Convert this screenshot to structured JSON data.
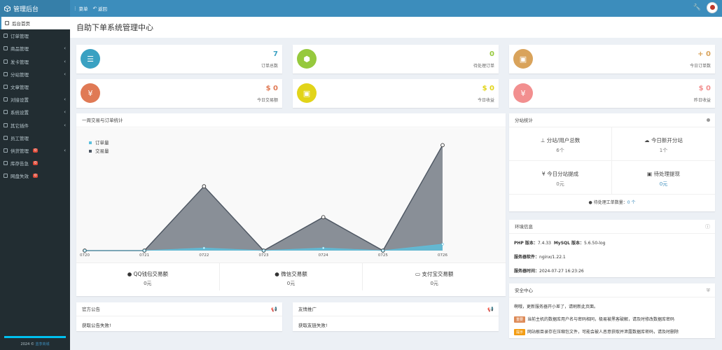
{
  "app": {
    "title": "管理后台"
  },
  "topnav": {
    "menu": "菜单",
    "back": "返回"
  },
  "sidebar": {
    "items": [
      {
        "label": "后台首页",
        "caret": false,
        "badge": ""
      },
      {
        "label": "订单管理",
        "caret": false,
        "badge": ""
      },
      {
        "label": "商品管理",
        "caret": true,
        "badge": ""
      },
      {
        "label": "发卡管理",
        "caret": true,
        "badge": ""
      },
      {
        "label": "分站管理",
        "caret": true,
        "badge": ""
      },
      {
        "label": "文章管理",
        "caret": false,
        "badge": ""
      },
      {
        "label": "对接设置",
        "caret": true,
        "badge": ""
      },
      {
        "label": "系统设置",
        "caret": true,
        "badge": ""
      },
      {
        "label": "其它插件",
        "caret": true,
        "badge": ""
      },
      {
        "label": "员工管理",
        "caret": false,
        "badge": ""
      },
      {
        "label": "供货管理",
        "caret": true,
        "badge": "0"
      },
      {
        "label": "库存告急",
        "caret": false,
        "badge": "0"
      },
      {
        "label": "网盘失效",
        "caret": false,
        "badge": "0"
      }
    ],
    "footer_year": "2024 ©",
    "footer_site": "蓝李商城"
  },
  "page": {
    "title": "自助下单系统管理中心"
  },
  "stats": [
    {
      "value": "7",
      "label": "订单总数",
      "color": "#3aa1c2",
      "icon": "list-icon"
    },
    {
      "value": "0",
      "label": "待处理订单",
      "color": "#96c93d",
      "icon": "box-icon"
    },
    {
      "value": "+ 0",
      "label": "今日订单数",
      "color": "#d9a35b",
      "icon": "briefcase-icon"
    },
    {
      "value": "$ 0",
      "label": "今日交易额",
      "color": "#e07a55",
      "icon": "yen-icon"
    },
    {
      "value": "$ 0",
      "label": "今日收益",
      "color": "#e2d419",
      "icon": "briefcase-icon"
    },
    {
      "value": "$ 0",
      "label": "昨日收益",
      "color": "#f28f8f",
      "icon": "yen-icon"
    }
  ],
  "weekly": {
    "title": "一周交易与订单统计",
    "pay": [
      {
        "label": "QQ钱包交易额",
        "value": "0元"
      },
      {
        "label": "微信交易额",
        "value": "0元"
      },
      {
        "label": "支付宝交易额",
        "value": "0元"
      }
    ]
  },
  "chart_data": {
    "type": "area",
    "categories": [
      "0720",
      "0721",
      "0722",
      "0723",
      "0724",
      "0725",
      "0726"
    ],
    "series": [
      {
        "name": "订单量",
        "values": [
          0,
          0,
          0.1,
          0,
          0.1,
          0,
          0.25
        ],
        "color": "#5bc0de"
      },
      {
        "name": "交易量",
        "values": [
          0,
          0,
          2.5,
          0,
          1.3,
          0,
          4.1
        ],
        "color": "#4d5662"
      }
    ],
    "ylim": [
      0,
      4.3
    ],
    "grid": false,
    "legend_position": "top-left"
  },
  "substation": {
    "title": "分站统计",
    "cells": [
      {
        "title": "分站/用户总数",
        "value": "6个",
        "icon": "sitemap-icon"
      },
      {
        "title": "今日新开分站",
        "value": "1个",
        "icon": "cloud-icon"
      },
      {
        "title": "¥ 今日分站提成",
        "value": "0元",
        "icon": ""
      },
      {
        "title": "待处理提现",
        "value": "0元",
        "icon": "money-icon"
      }
    ],
    "pending_label": "待处理工单数量：",
    "pending_value": "0 个"
  },
  "env": {
    "title": "环境信息",
    "php_label": "PHP 版本：",
    "php_value": "7.4.33",
    "mysql_label": "MySQL 版本：",
    "mysql_value": "5.6.50-log",
    "server_label": "服务器软件：",
    "server_value": "nginx/1.22.1",
    "time_label": "服务器时间：",
    "time_value": "2024-07-27 16:23:26"
  },
  "security": {
    "title": "安全中心",
    "intro": "啊哦，更新服务器开小差了，请刷新此页面。",
    "items": [
      {
        "tag": "重要",
        "text": "当前主机的数据库用户名与密码相同，极易被黑客破解，请及时修改数据库密码"
      },
      {
        "tag": "提示",
        "text": "网站根目录存在压缩包文件，可能会被人恶意获取并泄露数据库密码，请及时删除"
      }
    ]
  },
  "announce": {
    "title": "官方公告",
    "body": "获取公告失败!"
  },
  "friends": {
    "title": "友情推广",
    "body": "获取友链失败!"
  }
}
